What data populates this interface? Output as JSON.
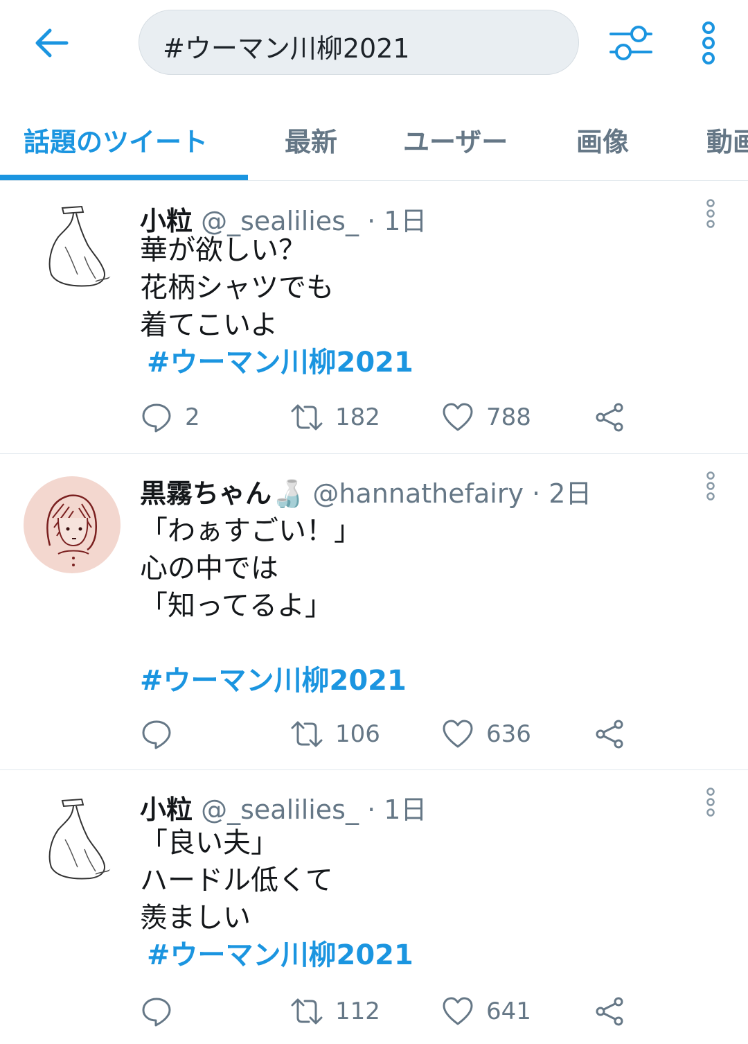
{
  "search": {
    "query": "#ウーマン川柳2021"
  },
  "tabs": [
    "話題のツイート",
    "最新",
    "ユーザー",
    "画像",
    "動画"
  ],
  "colors": {
    "accent": "#1b95e0",
    "muted": "#657786",
    "text": "#14171a"
  },
  "icons": {
    "back": "arrow-left-icon",
    "filter": "sliders-icon",
    "more": "more-vertical-icon",
    "reply": "reply-icon",
    "retweet": "retweet-icon",
    "like": "heart-icon",
    "share": "share-icon"
  },
  "tweets": [
    {
      "name": "小粒",
      "handle": "@_sealilies_",
      "time": "1日",
      "lines": [
        "華が欲しい？",
        "花柄シャツでも",
        "着てこいよ"
      ],
      "hashtag": "#ウーマン川柳2021",
      "reply_count": "2",
      "retweet_count": "182",
      "like_count": "788"
    },
    {
      "name": "黒霧ちゃん🍶",
      "handle": "@hannathefairy",
      "time": "2日",
      "lines": [
        "「わぁすごい！」",
        "心の中では",
        "「知ってるよ」",
        ""
      ],
      "hashtag": "#ウーマン川柳2021",
      "reply_count": "",
      "retweet_count": "106",
      "like_count": "636"
    },
    {
      "name": "小粒",
      "handle": "@_sealilies_",
      "time": "1日",
      "lines": [
        "「良い夫」",
        "ハードル低くて",
        "羨ましい"
      ],
      "hashtag": "#ウーマン川柳2021",
      "reply_count": "",
      "retweet_count": "112",
      "like_count": "641"
    }
  ]
}
